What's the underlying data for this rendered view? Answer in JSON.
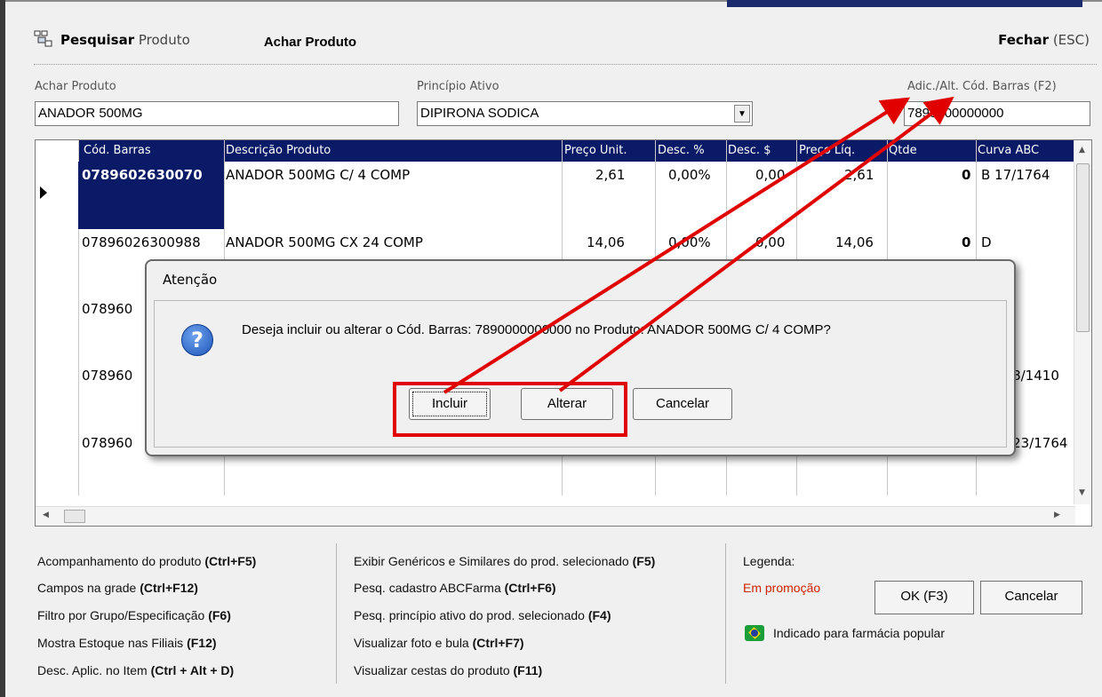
{
  "header": {
    "title_bold": "Pesquisar",
    "title_rest": "Produto",
    "tab_label": "Achar Produto",
    "close_label": "Fechar",
    "close_shortcut": "(ESC)"
  },
  "filters": {
    "achar_label": "Achar Produto",
    "achar_value": "ANADOR 500MG",
    "principio_label": "Princípio Ativo",
    "principio_value": "DIPIRONA SODICA",
    "barcode_label": "Adic./Alt. Cód. Barras (F2)",
    "barcode_value": "7890000000000"
  },
  "grid": {
    "columns": [
      "Cód. Barras",
      "Descrição Produto",
      "Preço Unit.",
      "Desc. %",
      "Desc. $",
      "Preço Líq.",
      "Qtde",
      "Curva ABC"
    ],
    "rows": [
      {
        "codigo": "0789602630070",
        "descricao": "ANADOR 500MG C/ 4 COMP",
        "preco_unit": "2,61",
        "desc_pct": "0,00%",
        "desc_val": "0,00",
        "preco_liq": "2,61",
        "qtde": "0",
        "curva": "B 17/1764"
      },
      {
        "codigo": "07896026300988",
        "descricao": "ANADOR 500MG CX 24 COMP",
        "preco_unit": "14,06",
        "desc_pct": "0,00%",
        "desc_val": "0,00",
        "preco_liq": "14,06",
        "qtde": "0",
        "curva": "D"
      },
      {
        "codigo": "078960",
        "descricao": "",
        "preco_unit": "",
        "desc_pct": "",
        "desc_val": "",
        "preco_liq": "",
        "qtde": "",
        "curva": ""
      },
      {
        "codigo": "078960",
        "descricao": "",
        "preco_unit": "",
        "desc_pct": "",
        "desc_val": "",
        "preco_liq": "",
        "qtde": "",
        "curva": "568/1410"
      },
      {
        "codigo": "078960",
        "descricao": "",
        "preco_unit": "",
        "desc_pct": "",
        "desc_val": "",
        "preco_liq": "",
        "qtde": "",
        "curva": "1123/1764"
      }
    ]
  },
  "dialog": {
    "title": "Atenção",
    "message": "Deseja incluir ou alterar o Cód. Barras: 7890000000000 no Produto: ANADOR 500MG C/ 4 COMP?",
    "btn_incluir": "Incluir",
    "btn_alterar": "Alterar",
    "btn_cancelar": "Cancelar"
  },
  "shortcuts_left": [
    {
      "text": "Acompanhamento do produto ",
      "key": "(Ctrl+F5)"
    },
    {
      "text": "Campos na grade ",
      "key": "(Ctrl+F12)"
    },
    {
      "text": "Filtro por Grupo/Especificação ",
      "key": "(F6)"
    },
    {
      "text": "Mostra Estoque nas Filiais  ",
      "key": "(F12)"
    },
    {
      "text": "Desc. Aplic. no Item  ",
      "key": "(Ctrl + Alt + D)"
    }
  ],
  "shortcuts_mid": [
    {
      "text": "Exibir Genéricos e Similares do prod. selecionado ",
      "key": "(F5)"
    },
    {
      "text": "Pesq. cadastro ABCFarma ",
      "key": "(Ctrl+F6)"
    },
    {
      "text": "Pesq. princípio ativo do prod. selecionado ",
      "key": "(F4)"
    },
    {
      "text": "Visualizar foto e bula ",
      "key": "(Ctrl+F7)"
    },
    {
      "text": "Visualizar cestas do produto ",
      "key": "(F11)"
    }
  ],
  "legend": {
    "title": "Legenda:",
    "promo": "Em promoção",
    "popular": "Indicado para farmácia popular",
    "promo_color": "#cc2200"
  },
  "actions": {
    "ok": "OK (F3)",
    "cancel": "Cancelar"
  },
  "annotation": {
    "color": "#e00000"
  }
}
